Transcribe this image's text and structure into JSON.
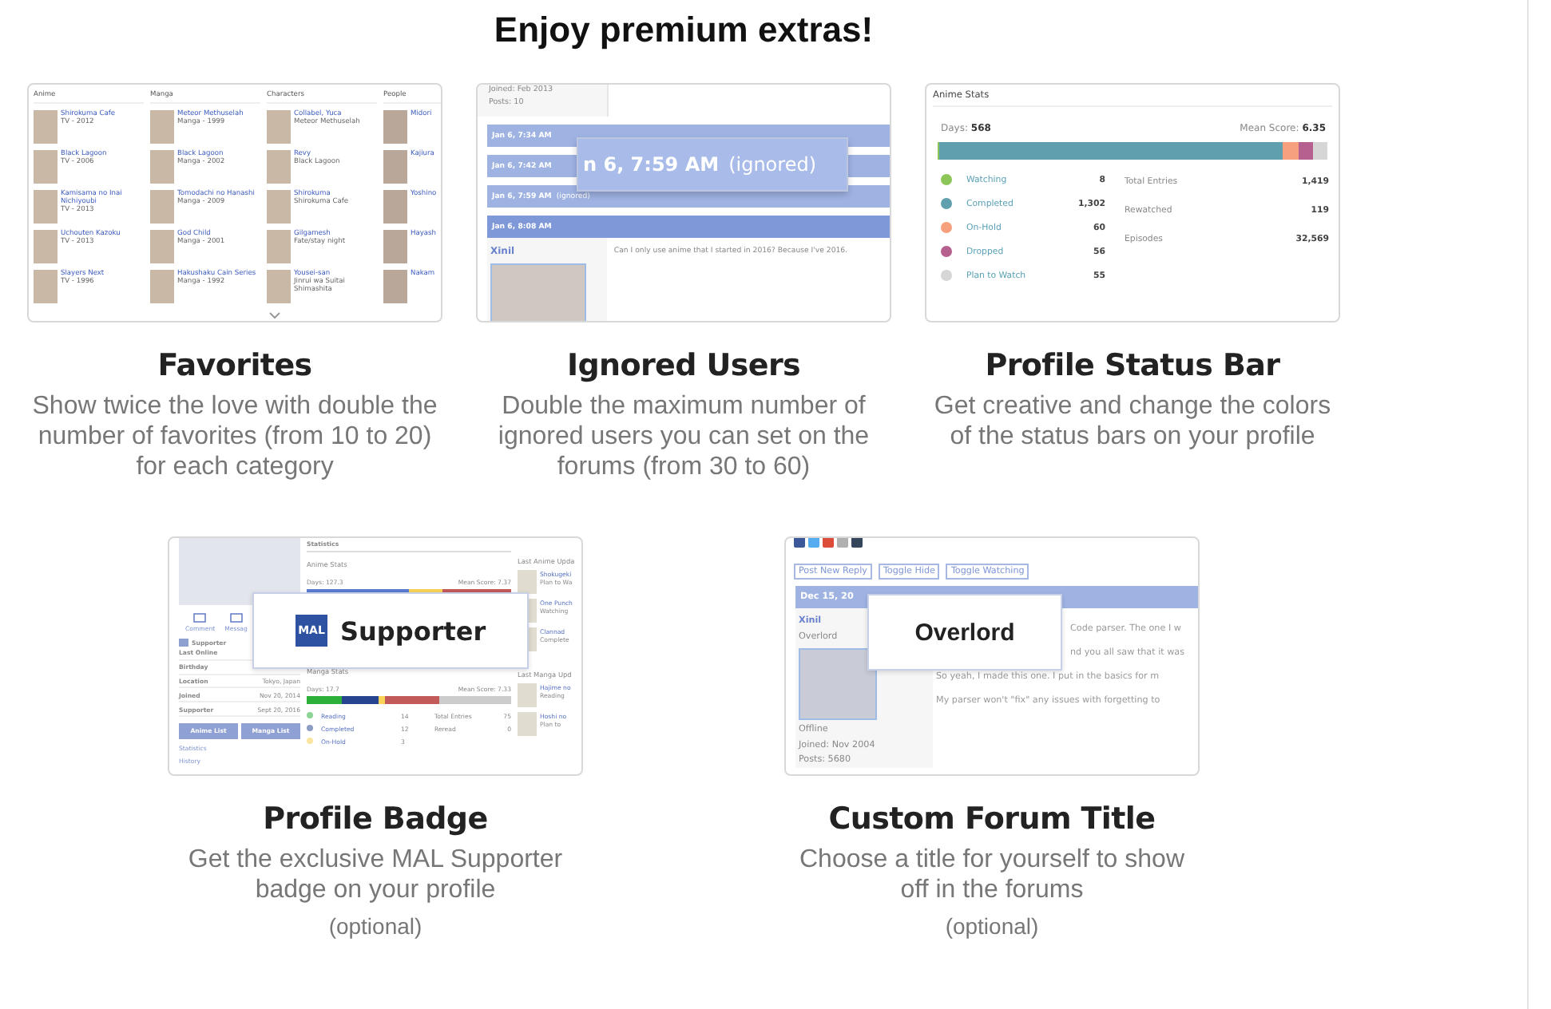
{
  "heading": "Enjoy premium extras!",
  "rows": [
    {
      "features": [
        {
          "kind": "favorites",
          "title": "Favorites",
          "description": "Show twice the love with double the number of favorites (from 10 to 20) for each category",
          "preview": {
            "columns": [
              {
                "heading": "Anime",
                "items": [
                  {
                    "title": "Shirokuma Cafe",
                    "sub": "TV - 2012"
                  },
                  {
                    "title": "Black Lagoon",
                    "sub": "TV - 2006"
                  },
                  {
                    "title": "Kamisama no Inai Nichiyoubi",
                    "sub": "TV - 2013"
                  },
                  {
                    "title": "Uchouten Kazoku",
                    "sub": "TV - 2013"
                  },
                  {
                    "title": "Slayers Next",
                    "sub": "TV - 1996"
                  }
                ]
              },
              {
                "heading": "Manga",
                "items": [
                  {
                    "title": "Meteor Methuselah",
                    "sub": "Manga - 1999"
                  },
                  {
                    "title": "Black Lagoon",
                    "sub": "Manga - 2002"
                  },
                  {
                    "title": "Tomodachi no Hanashi",
                    "sub": "Manga - 2009"
                  },
                  {
                    "title": "God Child",
                    "sub": "Manga - 2001"
                  },
                  {
                    "title": "Hakushaku Cain Series",
                    "sub": "Manga - 1992"
                  }
                ]
              },
              {
                "heading": "Characters",
                "items": [
                  {
                    "title": "Collabel, Yuca",
                    "sub": "Meteor Methuselah"
                  },
                  {
                    "title": "Revy",
                    "sub": "Black Lagoon"
                  },
                  {
                    "title": "Shirokuma",
                    "sub": "Shirokuma Cafe"
                  },
                  {
                    "title": "Gilgamesh",
                    "sub": "Fate/stay night"
                  },
                  {
                    "title": "Yousei-san",
                    "sub": "Jinrui wa Suitai Shimashita"
                  }
                ]
              },
              {
                "heading": "People",
                "items": [
                  {
                    "title": "Midori"
                  },
                  {
                    "title": "Kajiura"
                  },
                  {
                    "title": "Yoshino"
                  },
                  {
                    "title": "Hayash"
                  },
                  {
                    "title": "Nakam"
                  }
                ]
              }
            ]
          }
        },
        {
          "kind": "ignored",
          "title": "Ignored Users",
          "description": "Double the maximum number of ignored users you can set on the forums (from 30 to 60)",
          "preview": {
            "joined": "Joined: Feb 2013",
            "posts": "Posts: 10",
            "rows": [
              {
                "time": "Jan 6, 7:34 AM"
              },
              {
                "time": "Jan 6, 7:42 AM"
              },
              {
                "time": "Jan 6, 7:59 AM",
                "note": "(ignored)"
              }
            ],
            "post_time": "Jan 6, 8:08 AM",
            "user": "Xinil",
            "message": "Can I only use anime that I started in 2016? Because I've 2016.",
            "callout_time": "n 6, 7:59 AM",
            "callout_note": "(ignored)"
          }
        },
        {
          "kind": "stats",
          "title": "Profile Status Bar",
          "description": "Get creative and change the colors of the status bars on your profile",
          "preview": {
            "title": "Anime Stats",
            "days_label": "Days:",
            "days": "568",
            "mean_label": "Mean Score:",
            "mean": "6.35",
            "statuses": [
              {
                "label": "Watching",
                "count": "8",
                "color": "#8cc659"
              },
              {
                "label": "Completed",
                "count": "1,302",
                "color": "#5f9fae"
              },
              {
                "label": "On-Hold",
                "count": "60",
                "color": "#f6a07e"
              },
              {
                "label": "Dropped",
                "count": "56",
                "color": "#b6608f"
              },
              {
                "label": "Plan to Watch",
                "count": "55",
                "color": "#d6d6d6"
              }
            ],
            "totals": [
              {
                "label": "Total Entries",
                "value": "1,419"
              },
              {
                "label": "Rewatched",
                "value": "119"
              },
              {
                "label": "Episodes",
                "value": "32,569"
              }
            ]
          }
        }
      ]
    },
    {
      "features": [
        {
          "kind": "badge",
          "title": "Profile Badge",
          "description": "Get the exclusive MAL Supporter badge on your profile",
          "note": "(optional)",
          "preview": {
            "actions": [
              "Comment",
              "Messag"
            ],
            "badge_row": "Supporter",
            "info": [
              {
                "label": "Last Online"
              },
              {
                "label": "Birthday"
              },
              {
                "label": "Location",
                "value": "Tokyo, Japan"
              },
              {
                "label": "Joined",
                "value": "Nov 20, 2014"
              },
              {
                "label": "Supporter",
                "value": "Sept 20, 2016"
              }
            ],
            "buttons": [
              "Anime List",
              "Manga List"
            ],
            "links": [
              "Statistics",
              "History"
            ],
            "section": "Statistics",
            "anime_stats": "Anime Stats",
            "anime_days": "Days: 127.3",
            "anime_mean": "Mean Score: 7.37",
            "manga_stats": "Manga Stats",
            "manga_days": "Days: 17.7",
            "manga_mean": "Mean Score: 7.33",
            "legend": [
              {
                "label": "Reading",
                "count": "14",
                "color": "#8fd496"
              },
              {
                "label": "Completed",
                "count": "12",
                "color": "#8d9cc4"
              },
              {
                "label": "On-Hold",
                "count": "3",
                "color": "#fbe3a0"
              }
            ],
            "totals": [
              {
                "label": "Total Entries",
                "value": "75"
              },
              {
                "label": "Reread",
                "value": "0"
              }
            ],
            "updates": [
              {
                "heading": "Last Anime Upda",
                "items": [
                  {
                    "title": "Shokugeki",
                    "status": "Plan to Wa"
                  },
                  {
                    "title": "One Punch",
                    "status": "Watching"
                  },
                  {
                    "title": "Clannad",
                    "status": "Complete"
                  }
                ]
              },
              {
                "heading": "Last Manga Upd",
                "items": [
                  {
                    "title": "Hajime no",
                    "status": "Reading"
                  },
                  {
                    "title": "Hoshi no",
                    "status": "Plan to"
                  }
                ]
              }
            ],
            "logo": "MAL",
            "callout": "Supporter"
          }
        },
        {
          "kind": "forum",
          "title": "Custom Forum Title",
          "description": "Choose a title for yourself to show off in the forums",
          "note": "(optional)",
          "preview": {
            "buttons": [
              "Post New Reply",
              "Toggle Hide",
              "Toggle Watching"
            ],
            "date": "Dec 15, 20",
            "user": "Xinil",
            "user_title": "Overlord",
            "status": "Offline",
            "joined": "Joined: Nov 2004",
            "posts": "Posts: 5680",
            "lines": [
              "Code parser. The one I w",
              "nd you all saw that it was",
              "So yeah, I made this one. I put in the basics for m",
              "My parser won't \"fix\" any issues with forgetting to"
            ],
            "callout": "Overlord"
          }
        }
      ]
    }
  ]
}
